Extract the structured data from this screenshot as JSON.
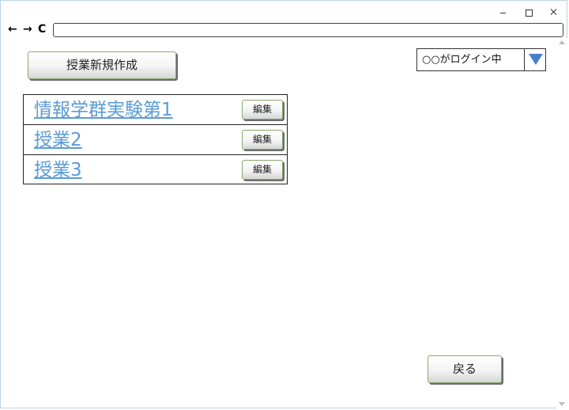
{
  "nav": {
    "back_icon": "arrow-left-icon",
    "forward_icon": "arrow-right-icon",
    "reload_icon": "reload-icon",
    "address_value": ""
  },
  "toolbar": {
    "create_label": "授業新規作成"
  },
  "login": {
    "status_text": "○○がログイン中"
  },
  "courses": [
    {
      "title": "情報学群実験第1",
      "edit_label": "編集"
    },
    {
      "title": "授業2",
      "edit_label": "編集"
    },
    {
      "title": "授業3",
      "edit_label": "編集"
    }
  ],
  "footer": {
    "back_label": "戻る"
  },
  "colors": {
    "link": "#5b9bd5",
    "dropdown_arrow": "#4a7fc8",
    "button_border": "#8aa86e"
  }
}
